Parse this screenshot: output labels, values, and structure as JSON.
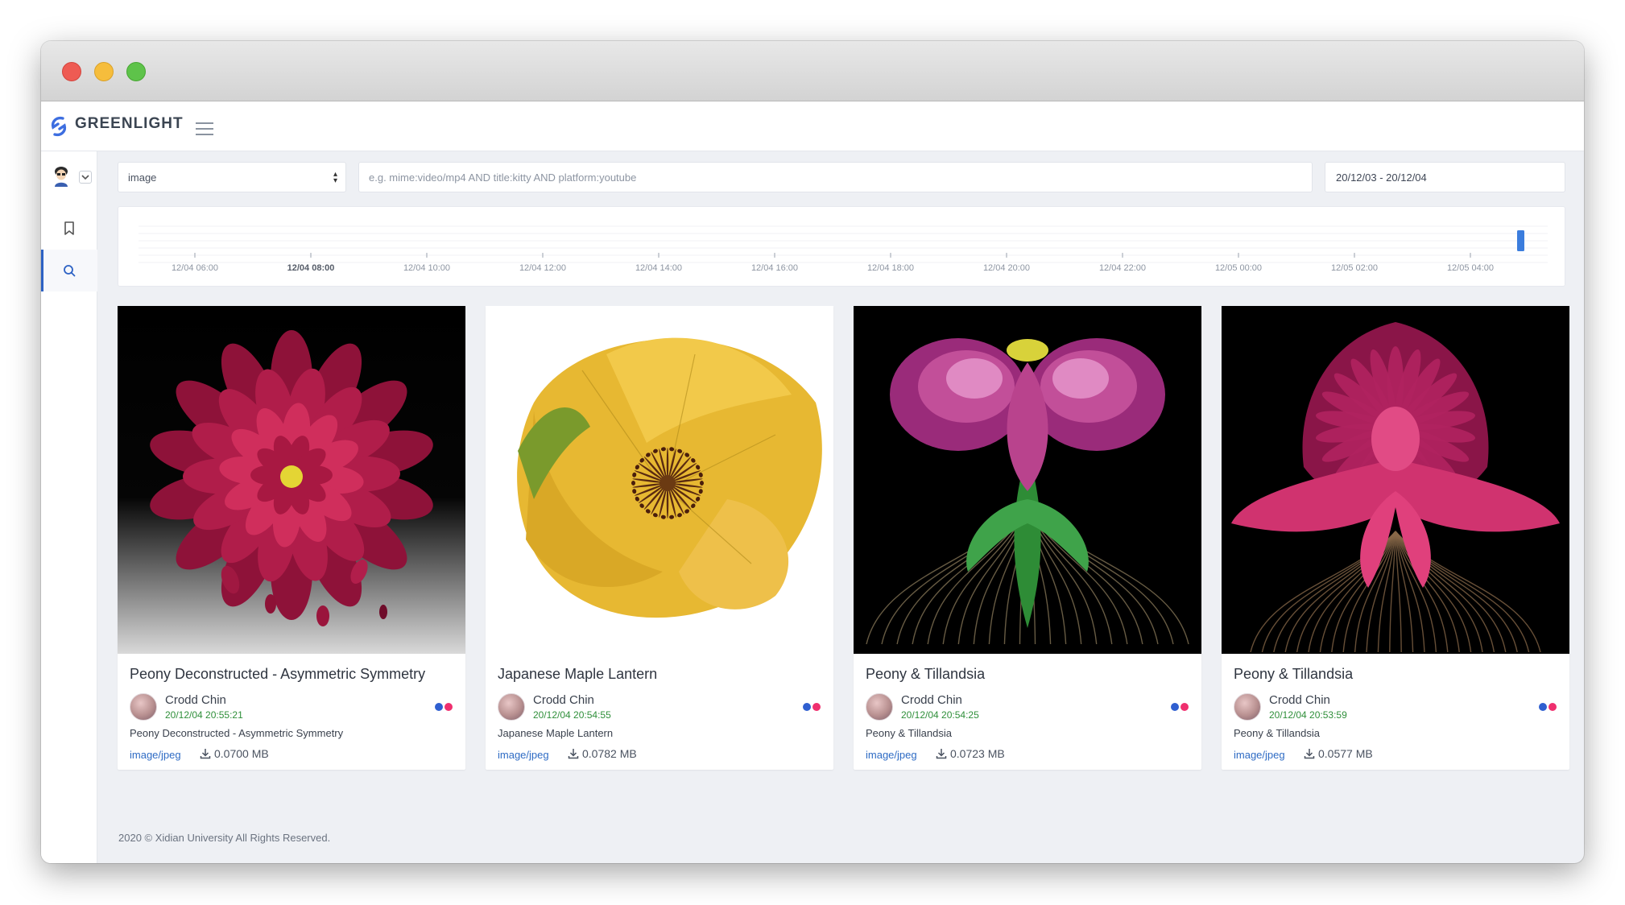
{
  "app": {
    "brand": "GREENLIGHT"
  },
  "sidebar": {
    "items": [
      {
        "name": "bookmark"
      },
      {
        "name": "search",
        "active": true
      }
    ]
  },
  "filters": {
    "type_value": "image",
    "query_placeholder": "e.g. mime:video/mp4 AND title:kitty AND platform:youtube",
    "date_range": "20/12/03 - 20/12/04"
  },
  "timeline": {
    "ticks": [
      "12/04 06:00",
      "12/04 08:00",
      "12/04 10:00",
      "12/04 12:00",
      "12/04 14:00",
      "12/04 16:00",
      "12/04 18:00",
      "12/04 20:00",
      "12/04 22:00",
      "12/05 00:00",
      "12/05 02:00",
      "12/05 04:00"
    ],
    "bold_tick_index": 1,
    "bar_color": "#3b7ddd"
  },
  "cards": [
    {
      "title": "Peony Deconstructed - Asymmetric Symmetry",
      "author": "Crodd Chin",
      "time": "20/12/04 20:55:21",
      "description": "Peony Deconstructed - Asymmetric Symmetry",
      "mime": "image/jpeg",
      "size": "0.0700 MB"
    },
    {
      "title": "Japanese Maple Lantern",
      "author": "Crodd Chin",
      "time": "20/12/04 20:54:55",
      "description": "Japanese Maple Lantern",
      "mime": "image/jpeg",
      "size": "0.0782 MB"
    },
    {
      "title": "Peony & Tillandsia",
      "author": "Crodd Chin",
      "time": "20/12/04 20:54:25",
      "description": "Peony & Tillandsia",
      "mime": "image/jpeg",
      "size": "0.0723 MB"
    },
    {
      "title": "Peony & Tillandsia",
      "author": "Crodd Chin",
      "time": "20/12/04 20:53:59",
      "description": "Peony & Tillandsia",
      "mime": "image/jpeg",
      "size": "0.0577 MB"
    }
  ],
  "colors": {
    "accent": "#2d62c4",
    "flickr_blue": "#2f5fd0",
    "flickr_pink": "#ef2f6e",
    "time_green": "#2f8f3a"
  },
  "footer": {
    "text": "2020 © Xidian University All Rights Reserved."
  }
}
